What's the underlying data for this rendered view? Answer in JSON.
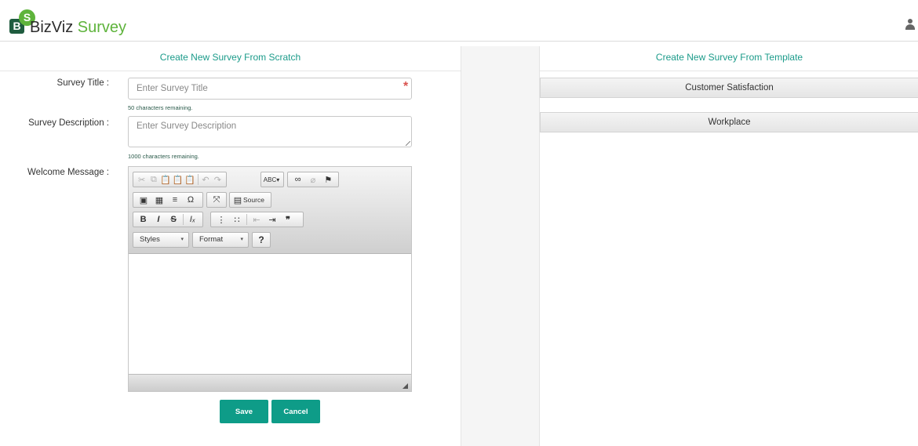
{
  "brand": {
    "logo_b": "B",
    "logo_s": "S",
    "name1": "BizViz",
    "name2": "Survey",
    "colors": {
      "accent": "#1b9b8a",
      "brand_green": "#5eb33b",
      "button": "#0e9c88"
    }
  },
  "header": {
    "user_icon": "user-icon"
  },
  "left": {
    "title": "Create New Survey From Scratch",
    "survey_title_label": "Survey Title :",
    "survey_title_placeholder": "Enter Survey Title",
    "survey_title_value": "",
    "title_hint": "50 characters remaining.",
    "required_mark": "*",
    "desc_label": "Survey Description :",
    "desc_placeholder": "Enter Survey Description",
    "desc_value": "",
    "desc_hint": "1000 characters remaining.",
    "welcome_label": "Welcome Message :",
    "editor": {
      "source_label": "Source",
      "styles_label": "Styles",
      "format_label": "Format",
      "help_label": "?",
      "content": ""
    },
    "save_label": "Save",
    "cancel_label": "Cancel"
  },
  "right": {
    "title": "Create New Survey From Template",
    "templates": [
      "Customer Satisfaction",
      "Workplace"
    ]
  }
}
